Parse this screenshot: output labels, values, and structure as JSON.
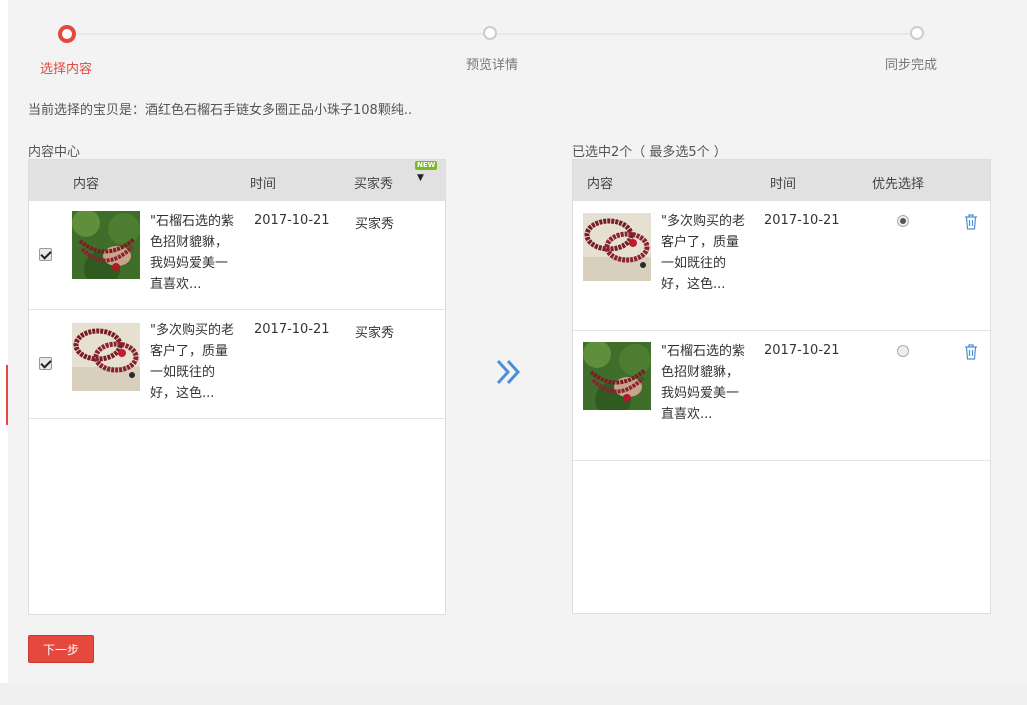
{
  "steps": [
    {
      "label": "选择内容",
      "state": "active"
    },
    {
      "label": "预览详情",
      "state": "inactive"
    },
    {
      "label": "同步完成",
      "state": "inactive"
    }
  ],
  "current_item": "当前选择的宝贝是：酒红色石榴石手链女多圈正品小珠子108颗纯..",
  "left_panel": {
    "title": "内容中心",
    "columns": {
      "content": "内容",
      "time": "时间",
      "type": "买家秀"
    },
    "new_badge": "NEW",
    "sort_icon": "▼",
    "rows": [
      {
        "checked": true,
        "desc": "\"石榴石选的紫色招财貔貅，我妈妈爱美一直喜欢...",
        "date": "2017-10-21",
        "type": "买家秀"
      },
      {
        "checked": true,
        "desc": "\"多次购买的老客户了，质量一如既往的好，这色...",
        "date": "2017-10-21",
        "type": "买家秀"
      }
    ]
  },
  "right_panel": {
    "title": "已选中2个（ 最多选5个 ）",
    "columns": {
      "content": "内容",
      "time": "时间",
      "priority": "优先选择"
    },
    "rows": [
      {
        "desc": "\"多次购买的老客户了，质量一如既往的好，这色...",
        "date": "2017-10-21",
        "priority": true
      },
      {
        "desc": "\"石榴石选的紫色招财貔貅，我妈妈爱美一直喜欢...",
        "date": "2017-10-21",
        "priority": false
      }
    ]
  },
  "transfer_icon": "double-chevron-right-icon",
  "next_button": "下一步",
  "colors": {
    "accent": "#e5483d",
    "link_blue": "#4a90d9",
    "new_badge": "#7ab829"
  }
}
